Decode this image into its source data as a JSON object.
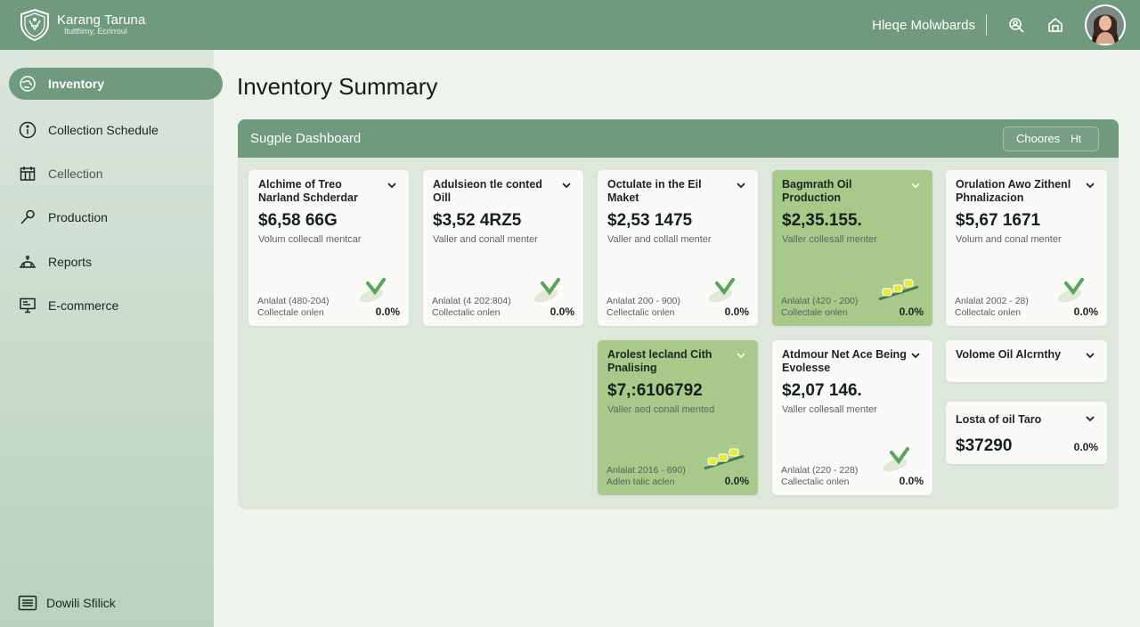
{
  "brand": {
    "name": "Karang Taruna",
    "tagline": "Itultfiimy, Ecrirroul",
    "logo_icon": "shield-crest-icon"
  },
  "user": {
    "name": "Hleqe Molwbards"
  },
  "topbar_icons": [
    "search-people-icon",
    "house-icon"
  ],
  "sidebar": {
    "items": [
      {
        "label": "Inventory",
        "icon": "globe-icon",
        "active": true
      },
      {
        "label": "Collection Schedule",
        "icon": "info-icon",
        "active": false
      },
      {
        "label": "Cellection",
        "icon": "calendar-icon",
        "active": false
      },
      {
        "label": "Production",
        "icon": "wrench-icon",
        "active": false
      },
      {
        "label": "Reports",
        "icon": "cloche-icon",
        "active": false
      },
      {
        "label": "E-commerce",
        "icon": "monitor-icon",
        "active": false
      }
    ],
    "footer": {
      "label": "Dowili Sfilick",
      "icon": "list-icon"
    }
  },
  "page": {
    "title": "Inventory Summary"
  },
  "panel": {
    "title": "Sugple Dashboard",
    "choose_label": "Choores",
    "choose_icon": "Ht"
  },
  "colors": {
    "topbar": "#6f9a7e",
    "card_highlight": "#a8c98a",
    "check": "#5aa35a"
  },
  "cards": [
    {
      "title": "Alchime of Treo Narland Schderdar",
      "value": "$6,58 66G",
      "sub": "Volum collecall mentcar",
      "foot1": "Anlalat (480-204)",
      "foot2": "Collectale onlen",
      "pct": "0.0%",
      "highlight": false,
      "graphic": "check-leaf"
    },
    {
      "title": "Adulsieon tle conted Oill",
      "value": "$3,52 4RZ5",
      "sub": "Valler and conall menter",
      "foot1": "Anlalat (4 202:804)",
      "foot2": "Collectalic onlen",
      "pct": "0.0%",
      "highlight": false,
      "graphic": "check-leaf"
    },
    {
      "title": "Octulate in the Eil Maket",
      "value": "$2,53 1475",
      "sub": "Valler and collall menter",
      "foot1": "Anlalat 200 - 900)",
      "foot2": "Cellectalic onlen",
      "pct": "0.0%",
      "highlight": false,
      "graphic": "check-leaf"
    },
    {
      "title": "Bagmrath Oil Production",
      "value": "$2,35.155.",
      "sub": "Valler collesall menter",
      "foot1": "Anlalat (420 - 200)",
      "foot2": "Collectale onlen",
      "pct": "0.0%",
      "highlight": true,
      "graphic": "bottles"
    },
    {
      "title": "Orulation Awo Zithenl Phnalizacion",
      "value": "$5,67 1671",
      "sub": "Volum and conal menter",
      "foot1": "Anlalat 2002 - 28)",
      "foot2": "Collectalc onlen",
      "pct": "0.0%",
      "highlight": false,
      "graphic": "check-leaf"
    },
    {
      "title": "Arolest lecland Cith Pnalising",
      "value": "$7,:6106792",
      "sub": "Valler aed conall mented",
      "foot1": "Anlalat 2016 - 690)",
      "foot2": "Adlen talic aclen",
      "pct": "0.0%",
      "highlight": true,
      "graphic": "bottles"
    },
    {
      "title": "Atdmour Net Ace Being Evolesse",
      "value": "$2,07 146.",
      "sub": "Valler collesall menter",
      "foot1": "Anlalat (220 - 228)",
      "foot2": "Callectalic onlen",
      "pct": "0.0%",
      "highlight": false,
      "graphic": "check-leaf"
    },
    {
      "title": "Volome Oil Alcrnthy",
      "value": "",
      "sub": "",
      "foot1": "",
      "foot2": "",
      "pct": "",
      "highlight": false,
      "graphic": "none"
    },
    {
      "title": "Losta of oil Taro",
      "value": "$37290",
      "sub": "",
      "foot1": "",
      "foot2": "",
      "pct": "0.0%",
      "highlight": false,
      "graphic": "none"
    }
  ]
}
